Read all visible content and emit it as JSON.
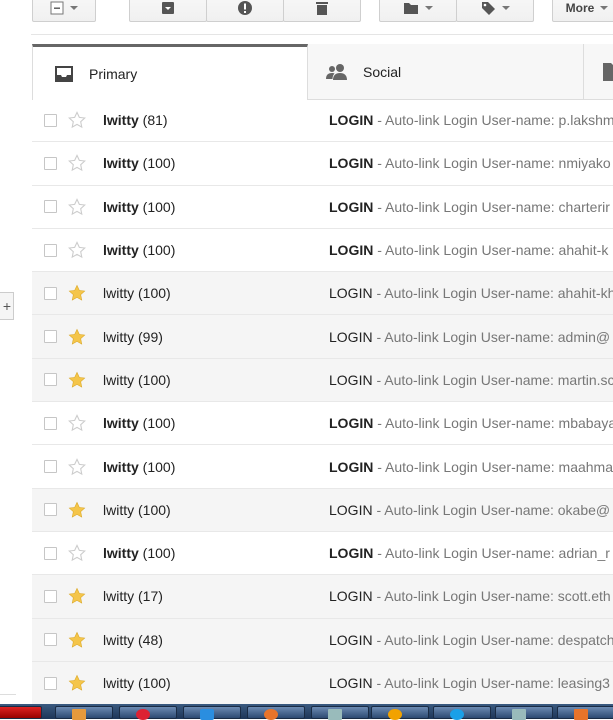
{
  "toolbar": {
    "more_label": "More"
  },
  "tabs": [
    {
      "label": "Primary",
      "icon": "inbox-icon"
    },
    {
      "label": "Social",
      "icon": "people-icon"
    }
  ],
  "emails": [
    {
      "sender": "lwitty",
      "count": "(81)",
      "title": "LOGIN",
      "snippet": " - Auto-link Login User-name: p.lakshm",
      "starred": false,
      "unread": true
    },
    {
      "sender": "lwitty",
      "count": "(100)",
      "title": "LOGIN",
      "snippet": " - Auto-link Login User-name: nmiyako",
      "starred": false,
      "unread": true
    },
    {
      "sender": "lwitty",
      "count": "(100)",
      "title": "LOGIN",
      "snippet": " - Auto-link Login User-name: charterir",
      "starred": false,
      "unread": true
    },
    {
      "sender": "lwitty",
      "count": "(100)",
      "title": "LOGIN",
      "snippet": " - Auto-link Login User-name: ahahit-k",
      "starred": false,
      "unread": true
    },
    {
      "sender": "lwitty",
      "count": "(100)",
      "title": "LOGIN",
      "snippet": " - Auto-link Login User-name: ahahit-kh",
      "starred": true,
      "unread": false
    },
    {
      "sender": "lwitty",
      "count": "(99)",
      "title": "LOGIN",
      "snippet": " - Auto-link Login User-name: admin@",
      "starred": true,
      "unread": false
    },
    {
      "sender": "lwitty",
      "count": "(100)",
      "title": "LOGIN",
      "snippet": " - Auto-link Login User-name: martin.sc",
      "starred": true,
      "unread": false
    },
    {
      "sender": "lwitty",
      "count": "(100)",
      "title": "LOGIN",
      "snippet": " - Auto-link Login User-name: mbabaya",
      "starred": false,
      "unread": true
    },
    {
      "sender": "lwitty",
      "count": "(100)",
      "title": "LOGIN",
      "snippet": " - Auto-link Login User-name: maahma",
      "starred": false,
      "unread": true
    },
    {
      "sender": "lwitty",
      "count": "(100)",
      "title": "LOGIN",
      "snippet": " - Auto-link Login User-name: okabe@",
      "starred": true,
      "unread": false
    },
    {
      "sender": "lwitty",
      "count": "(100)",
      "title": "LOGIN",
      "snippet": " - Auto-link Login User-name: adrian_r",
      "starred": false,
      "unread": true
    },
    {
      "sender": "lwitty",
      "count": "(17)",
      "title": "LOGIN",
      "snippet": " - Auto-link Login User-name: scott.eth",
      "starred": true,
      "unread": false
    },
    {
      "sender": "lwitty",
      "count": "(48)",
      "title": "LOGIN",
      "snippet": " - Auto-link Login User-name: despatch",
      "starred": true,
      "unread": false
    },
    {
      "sender": "lwitty",
      "count": "(100)",
      "title": "LOGIN",
      "snippet": " - Auto-link Login User-name: leasing3",
      "starred": true,
      "unread": false
    }
  ],
  "colors": {
    "star_on": "#f4c54a",
    "star_off": "#cccccc",
    "read_row": "#f5f5f5"
  }
}
